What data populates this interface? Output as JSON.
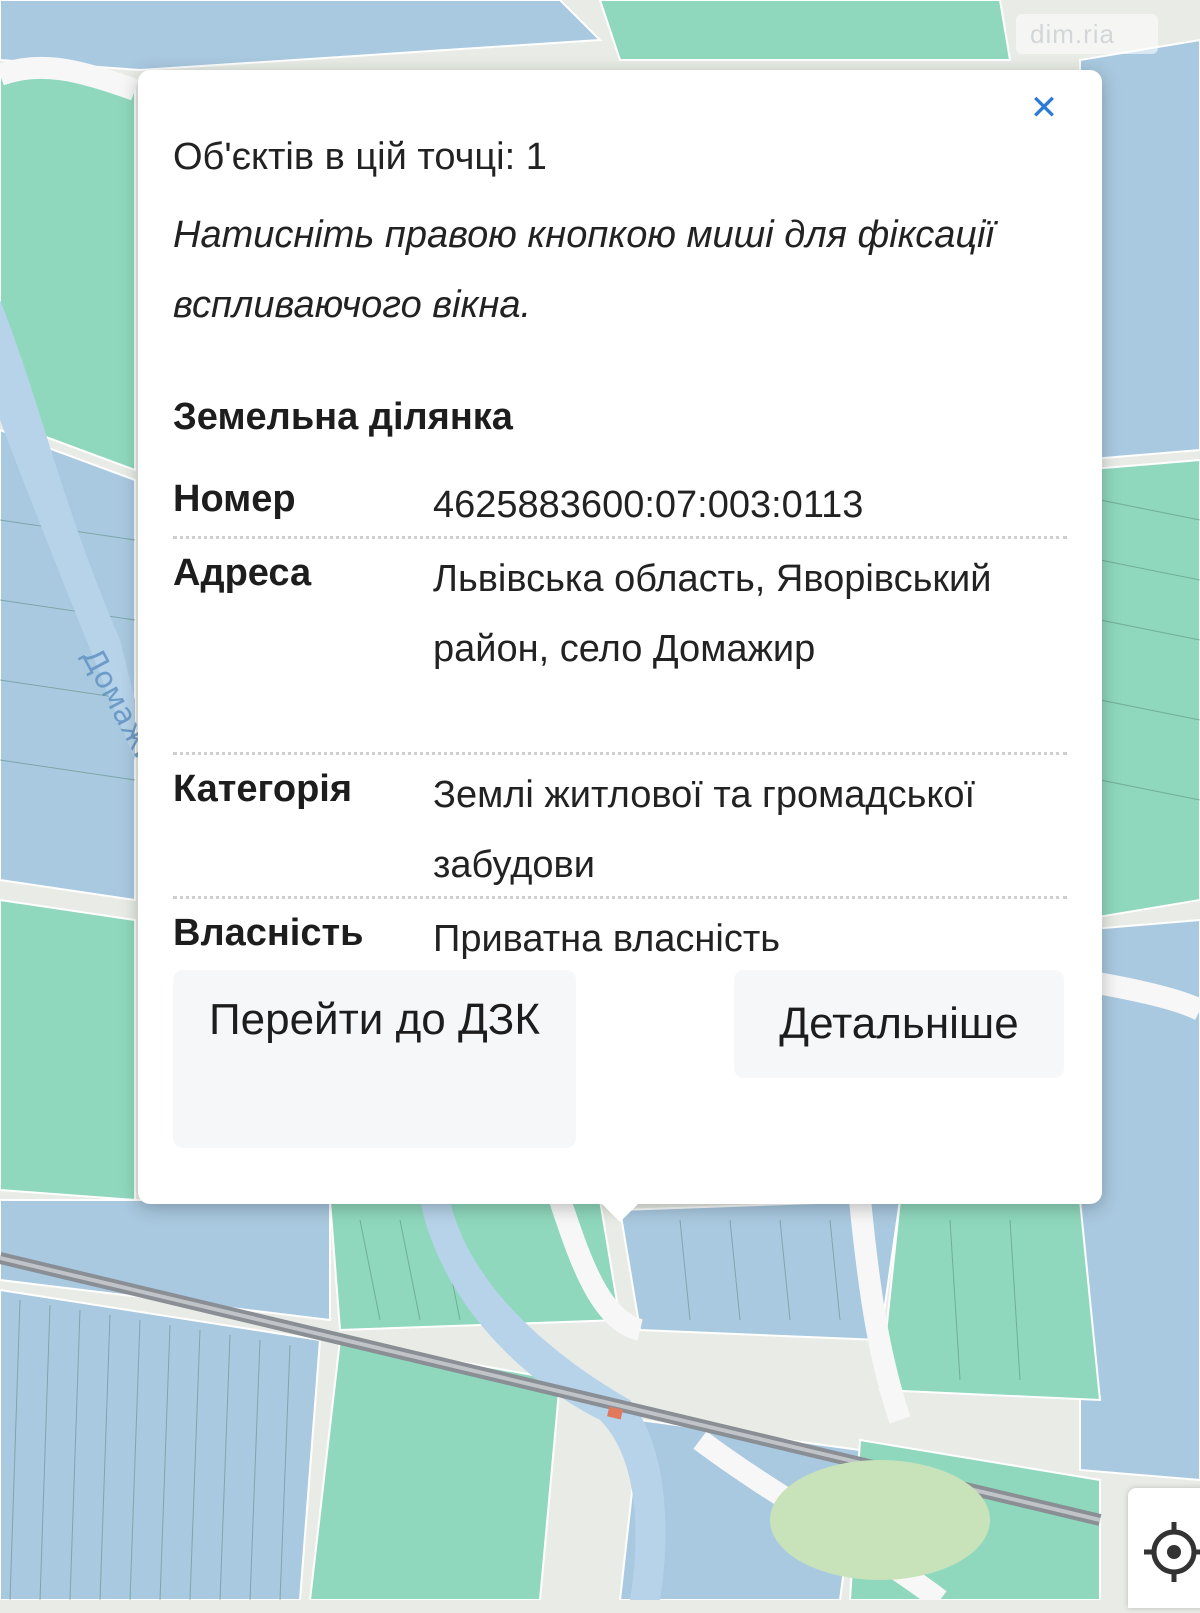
{
  "map": {
    "street_label": "Домажир",
    "colors": {
      "background": "#e9ece6",
      "parcel_green": "#8fd8bd",
      "parcel_blue": "#a9c9e0",
      "river": "#b7d3ea",
      "road": "#f7f7f7",
      "railway": "#8a8f95"
    }
  },
  "watermark": {
    "text": "dim.ria"
  },
  "popup": {
    "objects_count": "Об'єктів в цій точці: 1",
    "hint": "Натисніть правою кнопкою миші для фіксації вспливаючого вікна.",
    "section_title": "Земельна ділянка",
    "fields": [
      {
        "label": "Номер",
        "value": "4625883600:07:003:0113"
      },
      {
        "label": "Адреса",
        "value": "Львівська область, Яворівський район, село Домажир"
      },
      {
        "label": "Категорія",
        "value": "Землі житлової та громадської забудови"
      },
      {
        "label": "Власність",
        "value": "Приватна власність"
      }
    ],
    "buttons": {
      "go_to_dzk": "Перейти до ДЗК",
      "details": "Детальніше"
    },
    "close_icon": "close-icon"
  },
  "controls": {
    "locate_icon": "crosshair-locate-icon"
  }
}
